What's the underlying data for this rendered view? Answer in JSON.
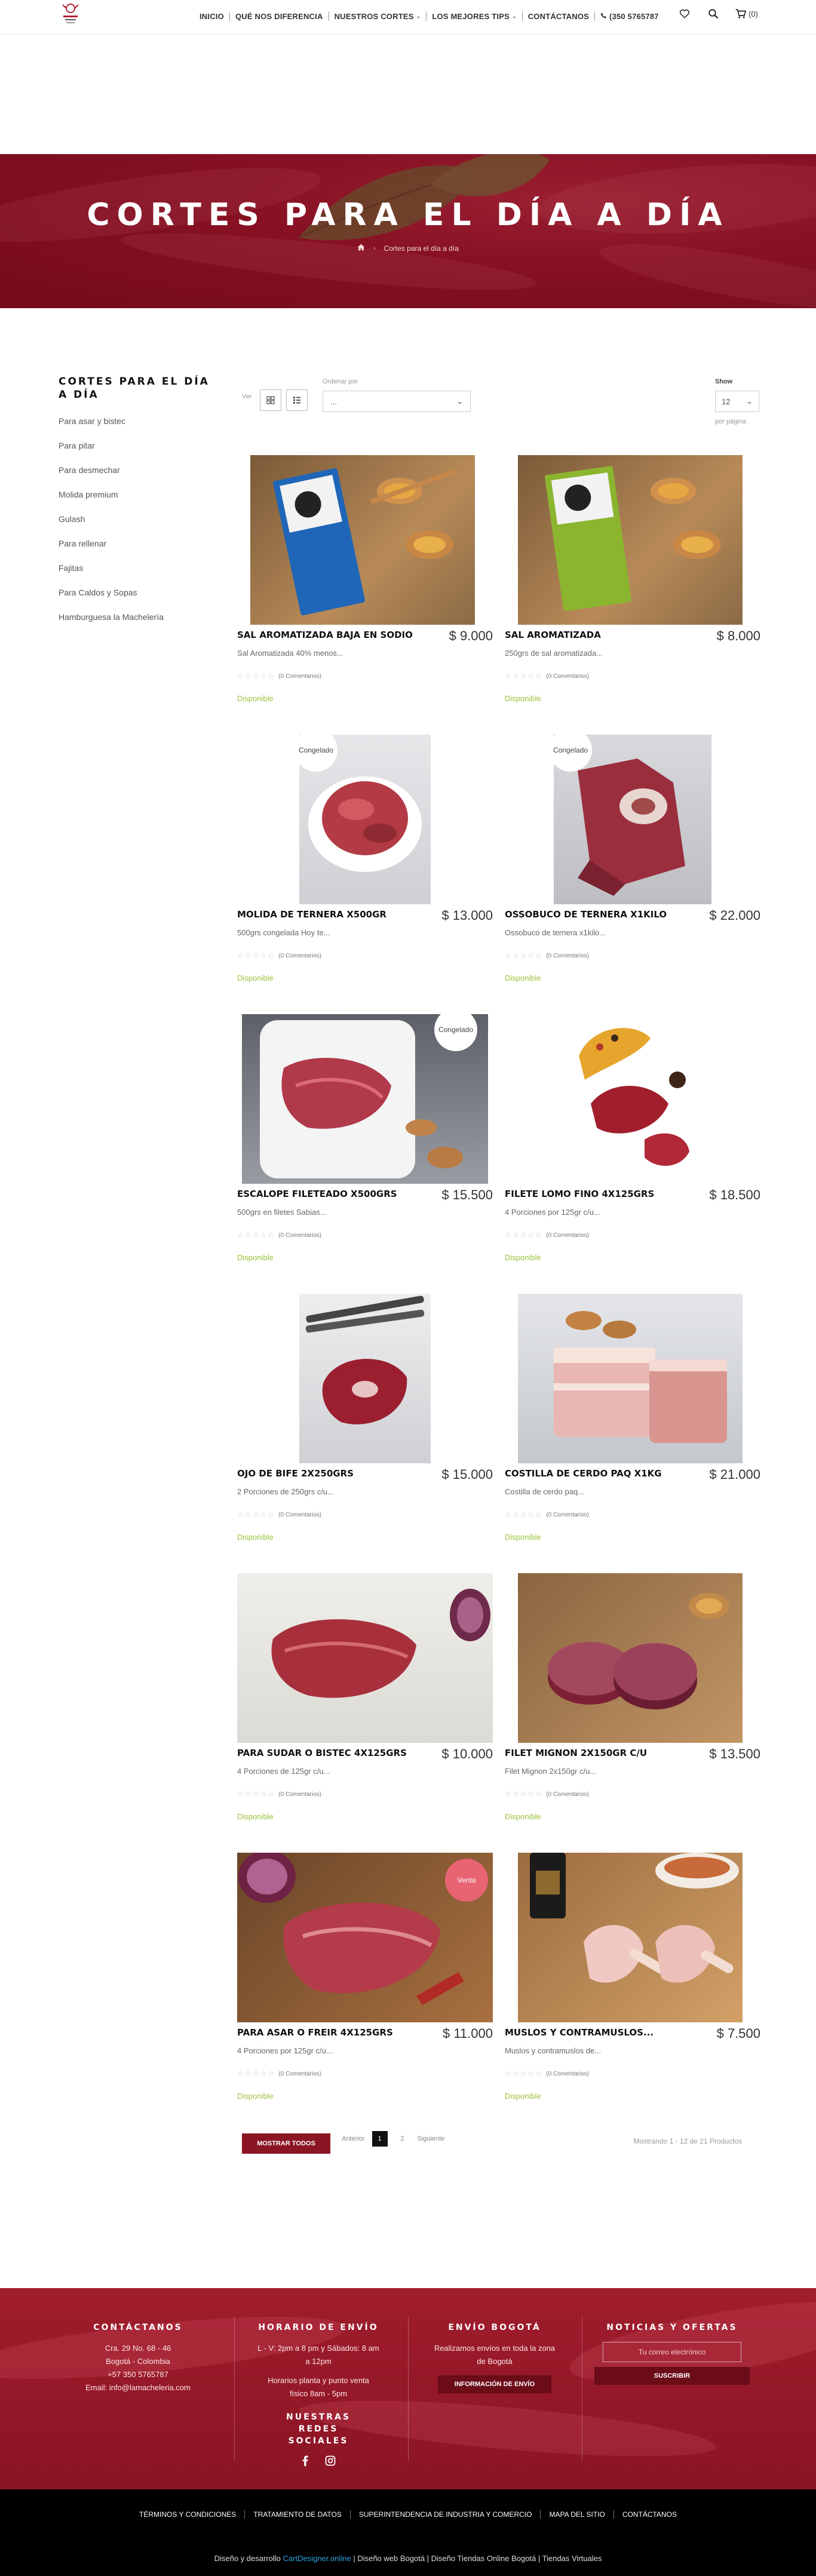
{
  "header": {
    "nav": [
      {
        "label": "INICIO",
        "has_dropdown": false
      },
      {
        "label": "QUÉ NOS DIFERENCIA",
        "has_dropdown": false
      },
      {
        "label": "NUESTROS CORTES",
        "has_dropdown": true
      },
      {
        "label": "LOS MEJORES TIPS",
        "has_dropdown": true
      },
      {
        "label": "CONTÁCTANOS",
        "has_dropdown": false
      },
      {
        "label": "(350 5765787",
        "has_dropdown": false
      }
    ],
    "phone_icon": "phone-icon",
    "icons": [
      "heart-icon",
      "search-icon",
      "cart-icon"
    ],
    "cart_count": "(0)"
  },
  "hero": {
    "title": "CORTES PARA EL DÍA A DÍA",
    "breadcrumb": [
      "home-icon",
      "Cortes para el día a día"
    ]
  },
  "sidebar": {
    "title": "CORTES PARA EL DÍA A DÍA",
    "items": [
      "Para asar y bistec",
      "Para pitar",
      "Para desmechar",
      "Molida premium",
      "Gulash",
      "Para rellenar",
      "Fajitas",
      "Para Caldos y Sopas",
      "Hamburguesa la Machelería"
    ]
  },
  "toolbar": {
    "view_label": "Ver",
    "order_label": "Ordenar por",
    "order_value": "...",
    "show_label": "Show",
    "show_value": "12",
    "per_page": "por página"
  },
  "products": [
    {
      "name": "SAL AROMATIZADA BAJA EN SODIO",
      "price": "$ 9.000",
      "desc": "Sal Aromatizada 40% menos...",
      "reviews": "(0 Comentarios)",
      "availability": "Disponible",
      "badge": "",
      "photo": "salt-blue"
    },
    {
      "name": "SAL AROMATIZADA",
      "price": "$ 8.000",
      "desc": "250grs de sal aromatizada...",
      "reviews": "(0 Comentarios)",
      "availability": "Disponible",
      "badge": "",
      "photo": "salt-green"
    },
    {
      "name": "MOLIDA DE TERNERA X500GR",
      "price": "$ 13.000",
      "desc": "500grs congelada Hoy te...",
      "reviews": "(0 Comentarios)",
      "availability": "Disponible",
      "badge": "Congelado",
      "photo": "ground"
    },
    {
      "name": "OSSOBUCO DE TERNERA X1KILO",
      "price": "$ 22.000",
      "desc": "Ossobuco de ternera x1kilo...",
      "reviews": "(0 Comentarios)",
      "availability": "Disponible",
      "badge": "Congelado",
      "photo": "ossobuco"
    },
    {
      "name": "ESCALOPE FILETEADO X500GRS",
      "price": "$ 15.500",
      "desc": "500grs en filetes Sabias...",
      "reviews": "(0 Comentarios)",
      "availability": "Disponible",
      "badge": "Congelado",
      "photo": "escalope"
    },
    {
      "name": "FILETE LOMO FINO 4X125GRS",
      "price": "$ 18.500",
      "desc": "4 Porciones por 125gr c/u...",
      "reviews": "(0 Comentarios)",
      "availability": "Disponible",
      "badge": "",
      "photo": "filete"
    },
    {
      "name": "OJO DE BIFE 2X250GRS",
      "price": "$ 15.000",
      "desc": "2 Porciones de 250grs c/u...",
      "reviews": "(0 Comentarios)",
      "availability": "Disponible",
      "badge": "",
      "photo": "ribeye"
    },
    {
      "name": "COSTILLA DE CERDO PAQ X1KG",
      "price": "$ 21.000",
      "desc": "Costilla de cerdo paq...",
      "reviews": "(0 Comentarios)",
      "availability": "Disponible",
      "badge": "",
      "photo": "pork"
    },
    {
      "name": "PARA SUDAR O BISTEC 4X125GRS",
      "price": "$ 10.000",
      "desc": "4 Porciones de 125gr c/u...",
      "reviews": "(0 Comentarios)",
      "availability": "Disponible",
      "badge": "",
      "photo": "bistec"
    },
    {
      "name": "FILET MIGNON 2X150GR C/U",
      "price": "$ 13.500",
      "desc": "Filet Mignon 2x150gr c/u...",
      "reviews": "(0 Comentarios)",
      "availability": "Disponible",
      "badge": "",
      "photo": "mignon"
    },
    {
      "name": "PARA ASAR O FREIR 4X125GRS",
      "price": "$ 11.000",
      "desc": "4 Porciones por 125gr c/u...",
      "reviews": "(0 Comentarios)",
      "availability": "Disponible",
      "badge": "Venta",
      "photo": "asar"
    },
    {
      "name": "MUSLOS Y CONTRAMUSLOS...",
      "price": "$ 7.500",
      "desc": "Muslos y contramuslos de...",
      "reviews": "(0 Comentarios)",
      "availability": "Disponible",
      "badge": "",
      "photo": "chicken"
    }
  ],
  "pagination": {
    "show_all": "MOSTRAR TODOS",
    "prev": "Anterior",
    "pages": [
      "1",
      "2"
    ],
    "next": "Siguiente",
    "showing": "Mostrando 1 - 12 de 21 Productos"
  },
  "footer": {
    "contact": {
      "title": "CONTÁCTANOS",
      "lines": [
        "Cra. 29 No. 68 - 46",
        "Bogotá - Colombia",
        "+57 350 5765787",
        "Email: info@lamacheleria.com"
      ]
    },
    "hours": {
      "title": "HORARIO DE ENVÍO",
      "lines": [
        "L - V: 2pm a 8 pm y Sábados: 8 am a 12pm",
        "Horarios planta y punto venta físico 8am - 5pm"
      ],
      "social_title": "NUESTRAS REDES SOCIALES",
      "social_icons": [
        "facebook-icon",
        "instagram-icon"
      ]
    },
    "shipping": {
      "title": "ENVÍO BOGOTÁ",
      "text": "Realizamos envíos en toda la zona de Bogotá",
      "button": "INFORMACIÓN DE ENVÍO"
    },
    "news": {
      "title": "NOTICIAS Y OFERTAS",
      "placeholder": "Tu correo electrónico",
      "button": "SUSCRIBIR"
    }
  },
  "bottom": {
    "links": [
      "TÉRMINOS Y CONDICIONES",
      "TRATAMIENTO DE DATOS",
      "SUPERINTENDENCIA DE INDUSTRIA Y COMERCIO",
      "MAPA DEL SITIO",
      "CONTÁCTANOS"
    ],
    "credits_prefix": "Diseño y desarrollo",
    "credits_brand": "CartDesigner.online",
    "credits_suffix": "| Diseño web Bogotá | Diseño Tiendas Online Bogotá | Tiendas Virtuales"
  }
}
